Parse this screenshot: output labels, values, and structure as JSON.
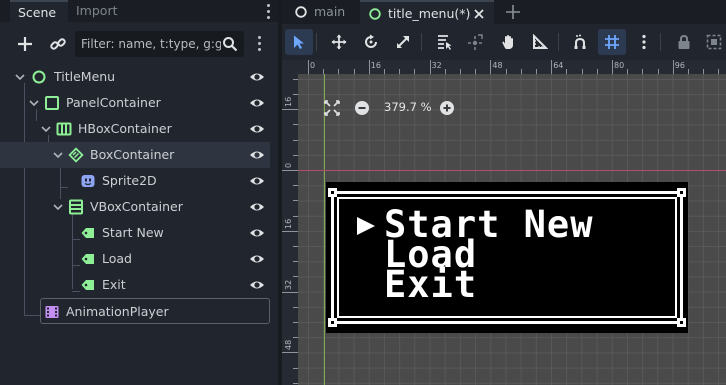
{
  "dock": {
    "tabs": [
      "Scene",
      "Import"
    ],
    "filter_placeholder": "Filter: name, t:type, g:gr"
  },
  "tree": {
    "nodes": [
      {
        "label": "TitleMenu",
        "icon": "node-circle-icon",
        "color": "#8eef97"
      },
      {
        "label": "PanelContainer",
        "icon": "panel-container-icon",
        "color": "#8eef97"
      },
      {
        "label": "HBoxContainer",
        "icon": "hbox-container-icon",
        "color": "#8eef97"
      },
      {
        "label": "BoxContainer",
        "icon": "box-container-icon",
        "color": "#8eef97"
      },
      {
        "label": "Sprite2D",
        "icon": "sprite2d-icon",
        "color": "#8da5f3"
      },
      {
        "label": "VBoxContainer",
        "icon": "vbox-container-icon",
        "color": "#8eef97"
      },
      {
        "label": "Start New",
        "icon": "label-icon",
        "color": "#8eef97"
      },
      {
        "label": "Load",
        "icon": "label-icon",
        "color": "#8eef97"
      },
      {
        "label": "Exit",
        "icon": "label-icon",
        "color": "#8eef97"
      },
      {
        "label": "AnimationPlayer",
        "icon": "animation-player-icon",
        "color": "#c38ef1"
      }
    ],
    "selected_index": 3
  },
  "editor": {
    "tabs": [
      {
        "label": "main",
        "icon": "scene-circle-icon"
      },
      {
        "label": "title_menu(*)",
        "icon": "scene-circle-icon"
      }
    ],
    "active_tab": 1,
    "toolbar_icons": [
      "select-icon",
      "move-icon",
      "rotate-icon",
      "scale-icon",
      "list-select-icon",
      "pivot-icon",
      "pan-icon",
      "ruler-icon",
      "smart-snap-icon",
      "grid-snap-icon",
      "more-icon",
      "lock-icon",
      "group-icon"
    ]
  },
  "viewport": {
    "zoom_level": "379.7 %",
    "ruler_top_labels": [
      "0",
      "16",
      "32",
      "48",
      "64",
      "80",
      "96"
    ],
    "ruler_left_labels": [
      "16",
      "0",
      "16",
      "32",
      "48"
    ],
    "menu_items": [
      "Start New",
      "Load",
      "Exit"
    ],
    "axis_colors": {
      "y": "#7faa4f",
      "x": "#b04d6a"
    }
  },
  "colors": {
    "accent": "#4a86e8",
    "node_green": "#8eef97",
    "node_blue": "#8da5f3",
    "node_purple": "#c38ef1"
  }
}
